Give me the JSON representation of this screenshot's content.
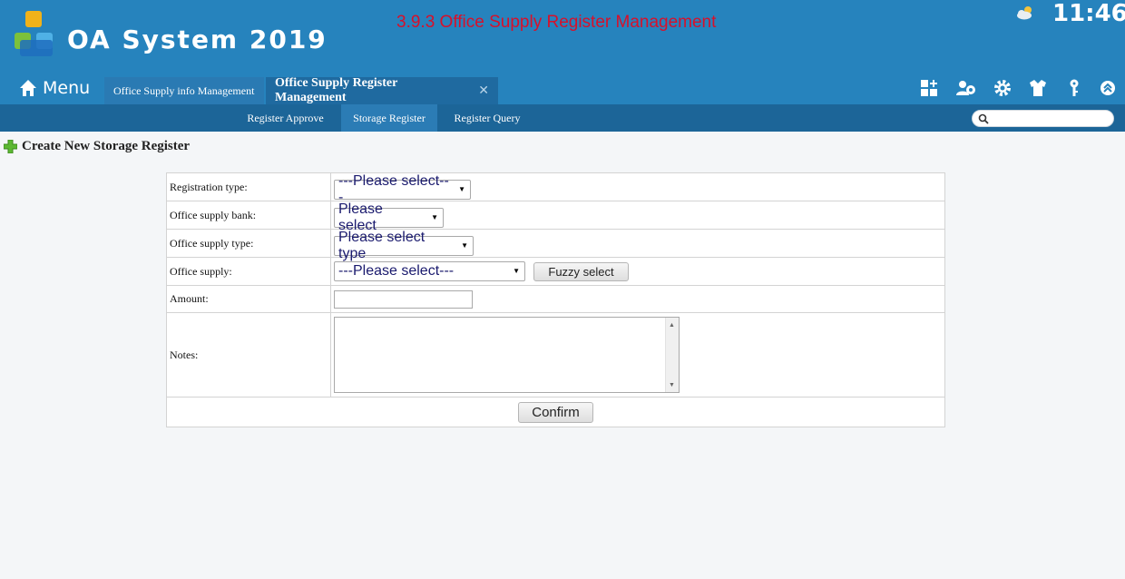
{
  "header": {
    "app_title": "OA System 2019",
    "module_title": "3.9.3 Office Supply Register Management",
    "time": "11:46",
    "weather_icon": "partly-cloudy-icon",
    "colors": {
      "header_bg": "#2683bd",
      "subnav_bg": "#1c6598",
      "module_title": "#d8102a"
    }
  },
  "menu": {
    "label": "Menu",
    "icon": "home-icon"
  },
  "tabs": [
    {
      "label": "Office Supply info Management",
      "active": false
    },
    {
      "label": "Office Supply Register Management",
      "active": true,
      "close": "✕"
    }
  ],
  "toolbar": {
    "icons": [
      "grid-plus-icon",
      "users-settings-icon",
      "gear-icon",
      "shirt-icon",
      "key-icon",
      "chevron-up-icon"
    ]
  },
  "subnav": {
    "items": [
      {
        "label": "Register Approve",
        "active": false
      },
      {
        "label": "Storage Register",
        "active": true
      },
      {
        "label": "Register Query",
        "active": false
      }
    ],
    "search_placeholder": ""
  },
  "section": {
    "title": "Create New Storage Register",
    "icon": "plus-icon"
  },
  "form": {
    "registration_type": {
      "label": "Registration type:",
      "value": "---Please select---"
    },
    "supply_bank": {
      "label": "Office supply bank:",
      "value": "Please select"
    },
    "supply_type": {
      "label": "Office supply type:",
      "value": "Please select type"
    },
    "supply": {
      "label": "Office supply:",
      "value": "---Please select---",
      "fuzzy_button": "Fuzzy select"
    },
    "amount": {
      "label": "Amount:",
      "value": ""
    },
    "notes": {
      "label": "Notes:",
      "value": ""
    },
    "confirm": "Confirm"
  }
}
